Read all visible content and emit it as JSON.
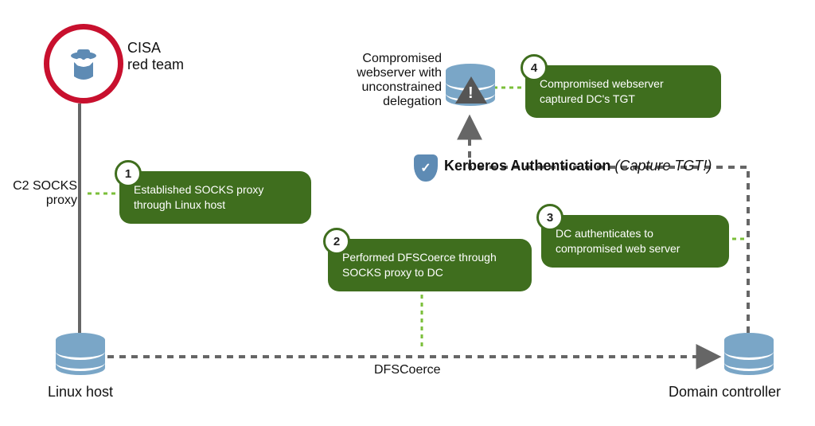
{
  "actor": {
    "label": "CISA\nred team"
  },
  "nodes": {
    "linux_host": "Linux host",
    "dc": "Domain controller",
    "compromised_ws": "Compromised\nwebserver with\nunconstrained\ndelegation"
  },
  "edges": {
    "c2_socks": "C2 SOCKS\nproxy",
    "dfscoerce": "DFSCoerce",
    "kerberos_strong": "Kerberos Authentication",
    "kerberos_note": " (Capture TGT!)"
  },
  "steps": {
    "1": "Established SOCKS proxy through Linux host",
    "2": "Performed DFSCoerce through SOCKS proxy to DC",
    "3": "DC authenticates to compromised web server",
    "4": "Compromised webserver captured DC's TGT"
  },
  "badges": {
    "1": "1",
    "2": "2",
    "3": "3",
    "4": "4"
  }
}
